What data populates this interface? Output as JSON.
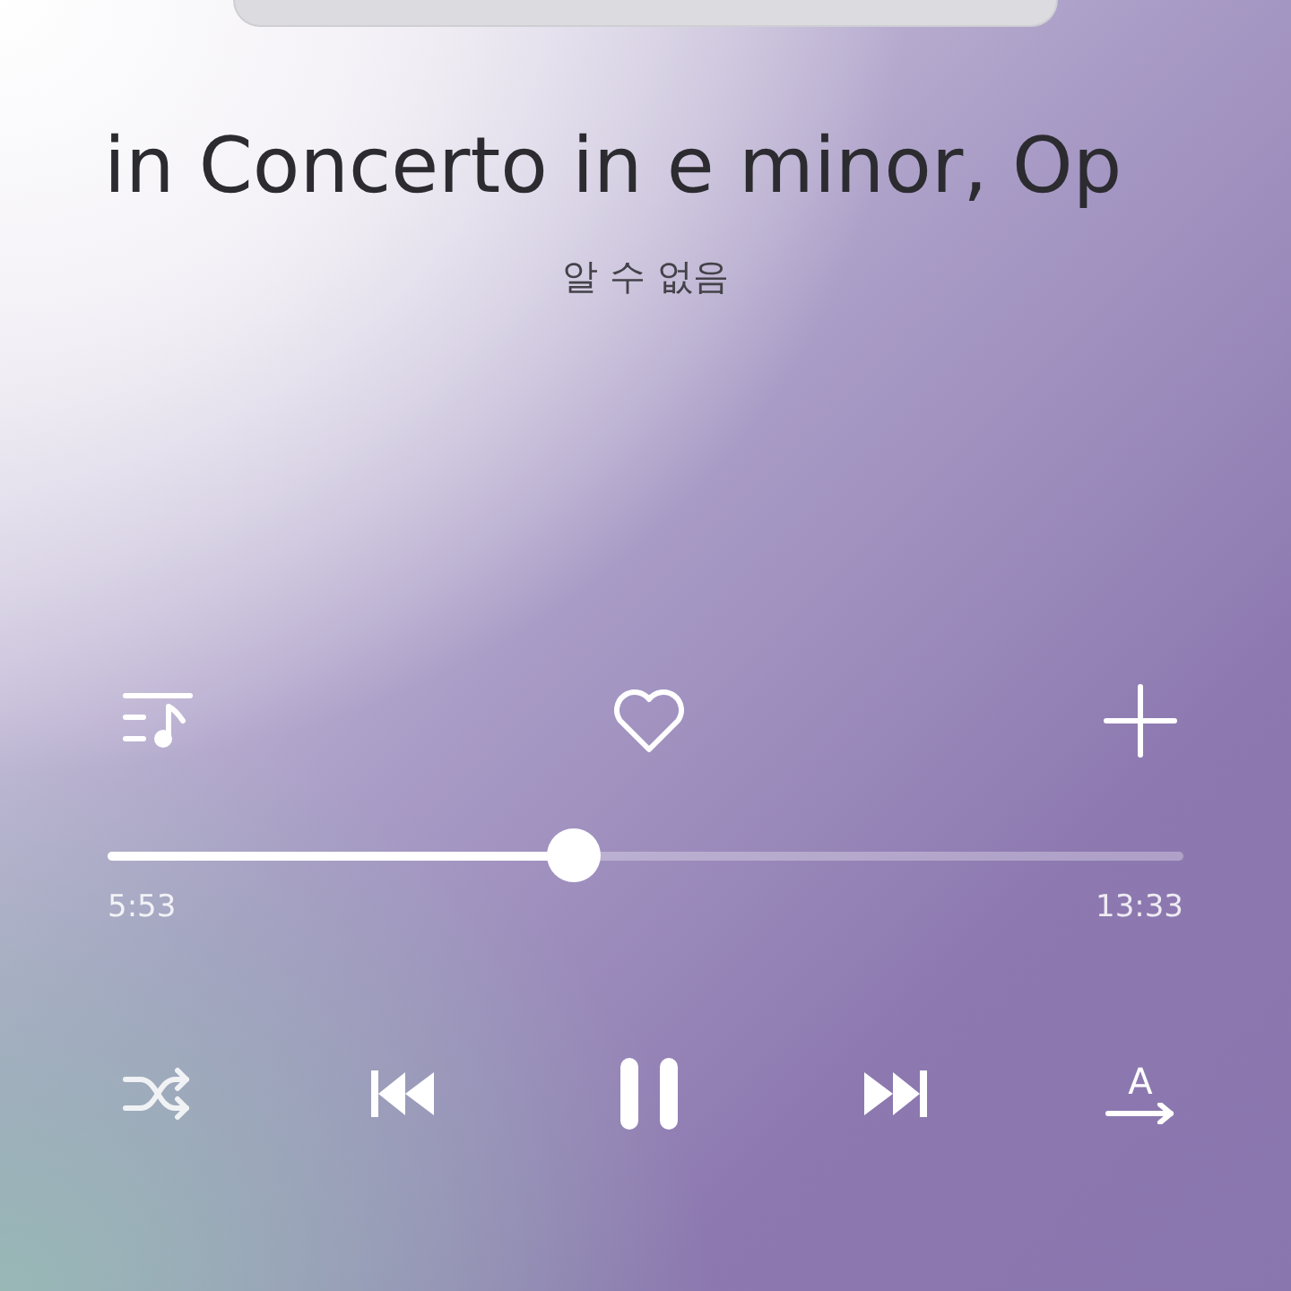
{
  "track": {
    "title": "in Concerto in e minor, Op",
    "artist": "알 수 없음"
  },
  "actions": [
    {
      "kind": "playlist"
    },
    {
      "kind": "favorite",
      "on": false
    },
    {
      "kind": "add"
    }
  ],
  "seek": {
    "level": 0.433,
    "elapsed": "5:53",
    "duration": "13:33"
  },
  "controls": [
    {
      "kind": "shuffle",
      "on": false
    },
    {
      "kind": "previous"
    },
    {
      "kind": "play-pause",
      "playing": true
    },
    {
      "kind": "next"
    },
    {
      "kind": "lyrics",
      "label": "A"
    }
  ]
}
